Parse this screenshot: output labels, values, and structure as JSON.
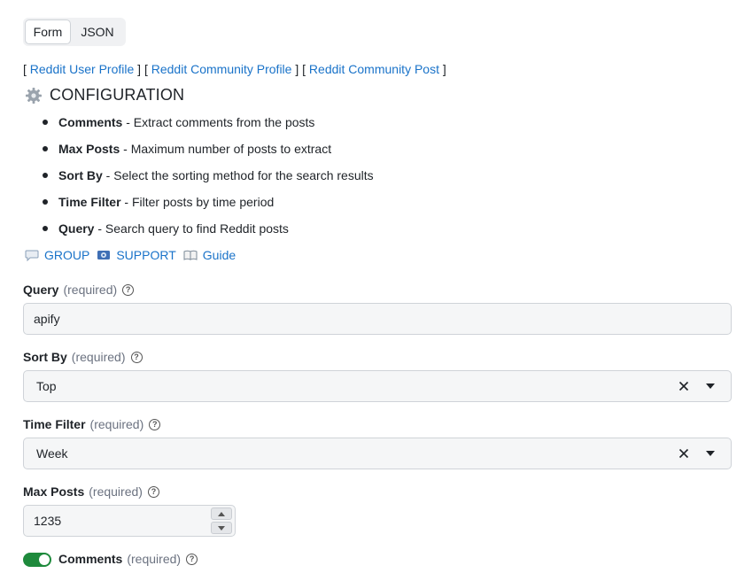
{
  "tabs": [
    {
      "label": "Form",
      "active": true
    },
    {
      "label": "JSON",
      "active": false
    }
  ],
  "links": {
    "open": "[",
    "sep": "] [",
    "close": "]",
    "items": [
      "Reddit User Profile",
      "Reddit Community Profile",
      "Reddit Community Post"
    ]
  },
  "config": {
    "title": "CONFIGURATION",
    "icon": "gear-icon",
    "items": [
      {
        "name": "Comments",
        "desc": " - Extract comments from the posts"
      },
      {
        "name": "Max Posts",
        "desc": " - Maximum number of posts to extract"
      },
      {
        "name": "Sort By",
        "desc": " - Select the sorting method for the search results"
      },
      {
        "name": "Time Filter",
        "desc": " - Filter posts by time period"
      },
      {
        "name": "Query",
        "desc": " - Search query to find Reddit posts"
      }
    ]
  },
  "community_links": [
    {
      "label": "GROUP",
      "icon": "speech-bubble-icon"
    },
    {
      "label": "SUPPORT",
      "icon": "support-icon"
    },
    {
      "label": "Guide",
      "icon": "book-icon"
    }
  ],
  "fields": {
    "required_text": "(required)",
    "query": {
      "label": "Query",
      "value": "apify"
    },
    "sort_by": {
      "label": "Sort By",
      "value": "Top"
    },
    "time_filter": {
      "label": "Time Filter",
      "value": "Week"
    },
    "max_posts": {
      "label": "Max Posts",
      "value": "1235"
    },
    "comments": {
      "label": "Comments",
      "enabled": true
    }
  },
  "colors": {
    "link": "#1a73c9",
    "toggle_on": "#1e8a3c"
  }
}
